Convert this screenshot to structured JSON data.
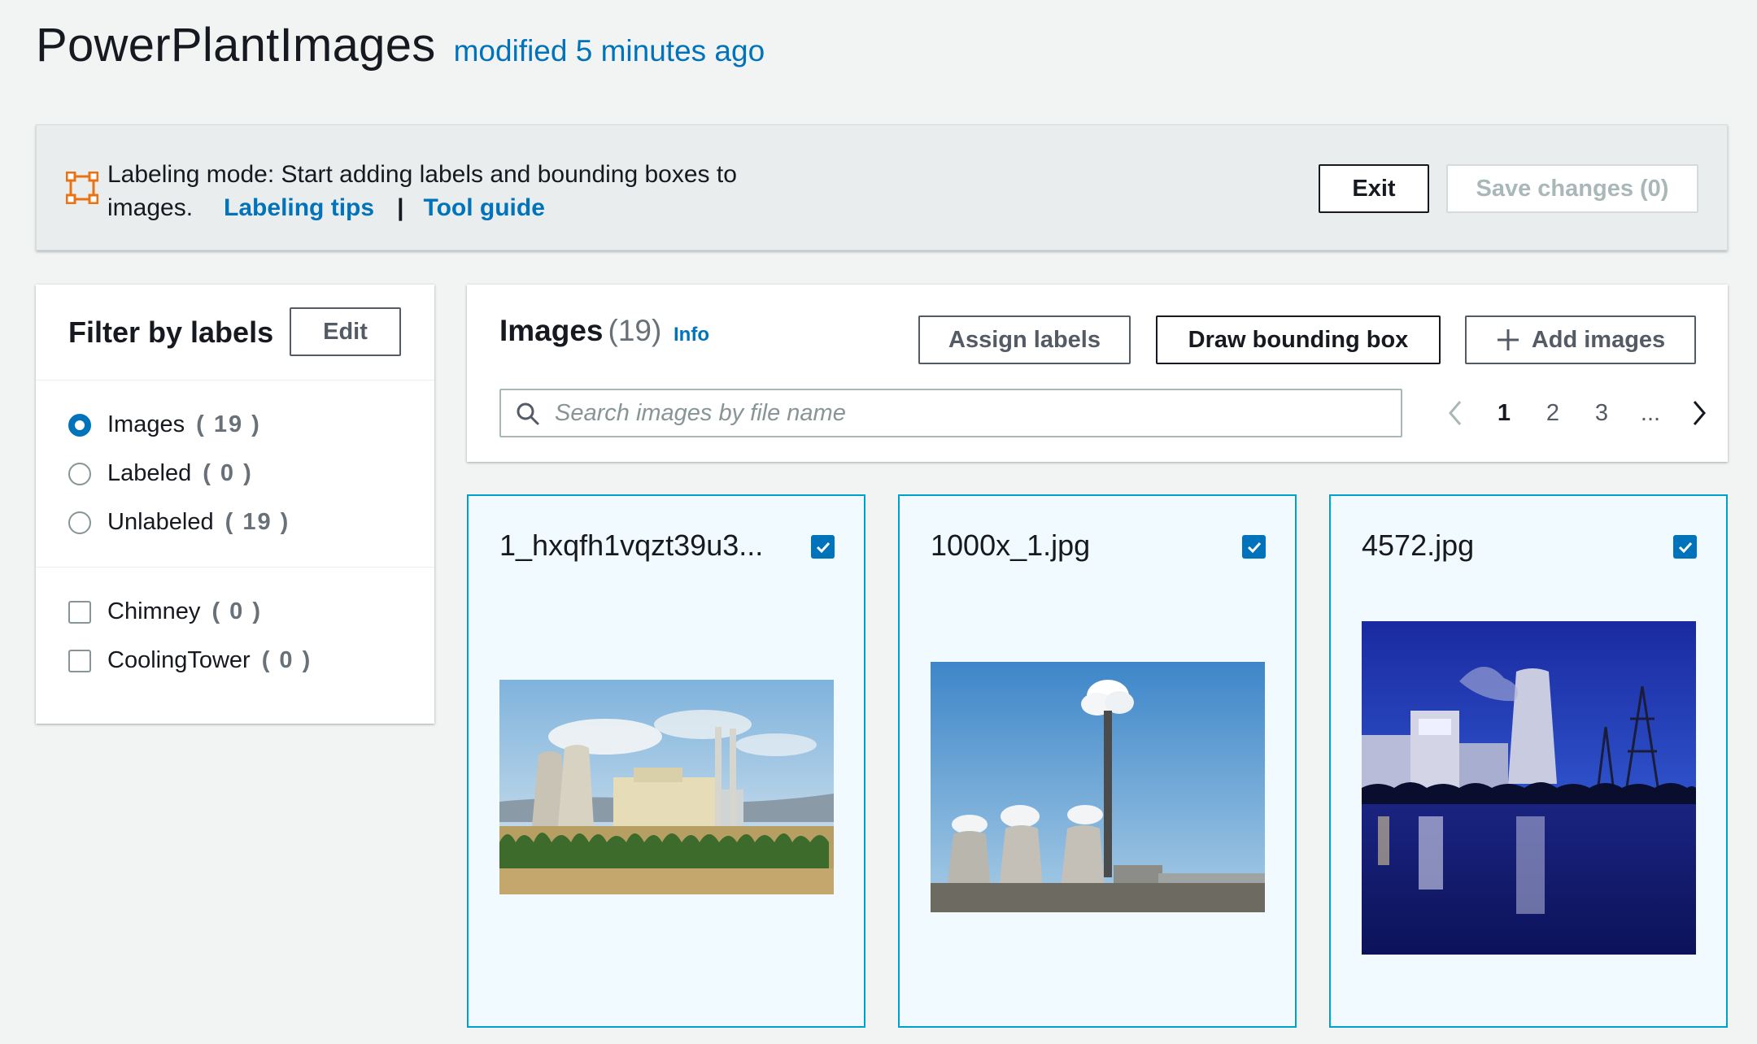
{
  "header": {
    "title": "PowerPlantImages",
    "subtitle": "modified 5 minutes ago"
  },
  "banner": {
    "icon": "bounding-box-icon",
    "text_line1": "Labeling mode: Start adding labels and bounding boxes to",
    "text_line2": "images.",
    "labeling_tips": "Labeling tips",
    "separator": "|",
    "tool_guide": "Tool guide",
    "exit_label": "Exit",
    "save_label": "Save changes (0)"
  },
  "filter": {
    "title": "Filter by labels",
    "edit_label": "Edit",
    "radios": [
      {
        "label": "Images",
        "count": "( 19 )",
        "selected": true
      },
      {
        "label": "Labeled",
        "count": "( 0 )",
        "selected": false
      },
      {
        "label": "Unlabeled",
        "count": "( 19 )",
        "selected": false
      }
    ],
    "labels": [
      {
        "label": "Chimney",
        "count": "( 0 )",
        "checked": false
      },
      {
        "label": "CoolingTower",
        "count": "( 0 )",
        "checked": false
      }
    ]
  },
  "images": {
    "title": "Images",
    "count": "(19)",
    "info": "Info",
    "assign_label": "Assign labels",
    "draw_label": "Draw bounding box",
    "add_label": "Add images",
    "search_placeholder": "Search images by file name",
    "pages": [
      "1",
      "2",
      "3",
      "..."
    ],
    "current_page": "1"
  },
  "cards": [
    {
      "name": "1_hxqfh1vqzt39u3...",
      "checked": true
    },
    {
      "name": "1000x_1.jpg",
      "checked": true
    },
    {
      "name": "4572.jpg",
      "checked": true
    }
  ],
  "colors": {
    "accent": "#0073bb",
    "card_border": "#00a1c9",
    "card_bg": "#f1faff",
    "banner_icon": "#ec7211"
  }
}
